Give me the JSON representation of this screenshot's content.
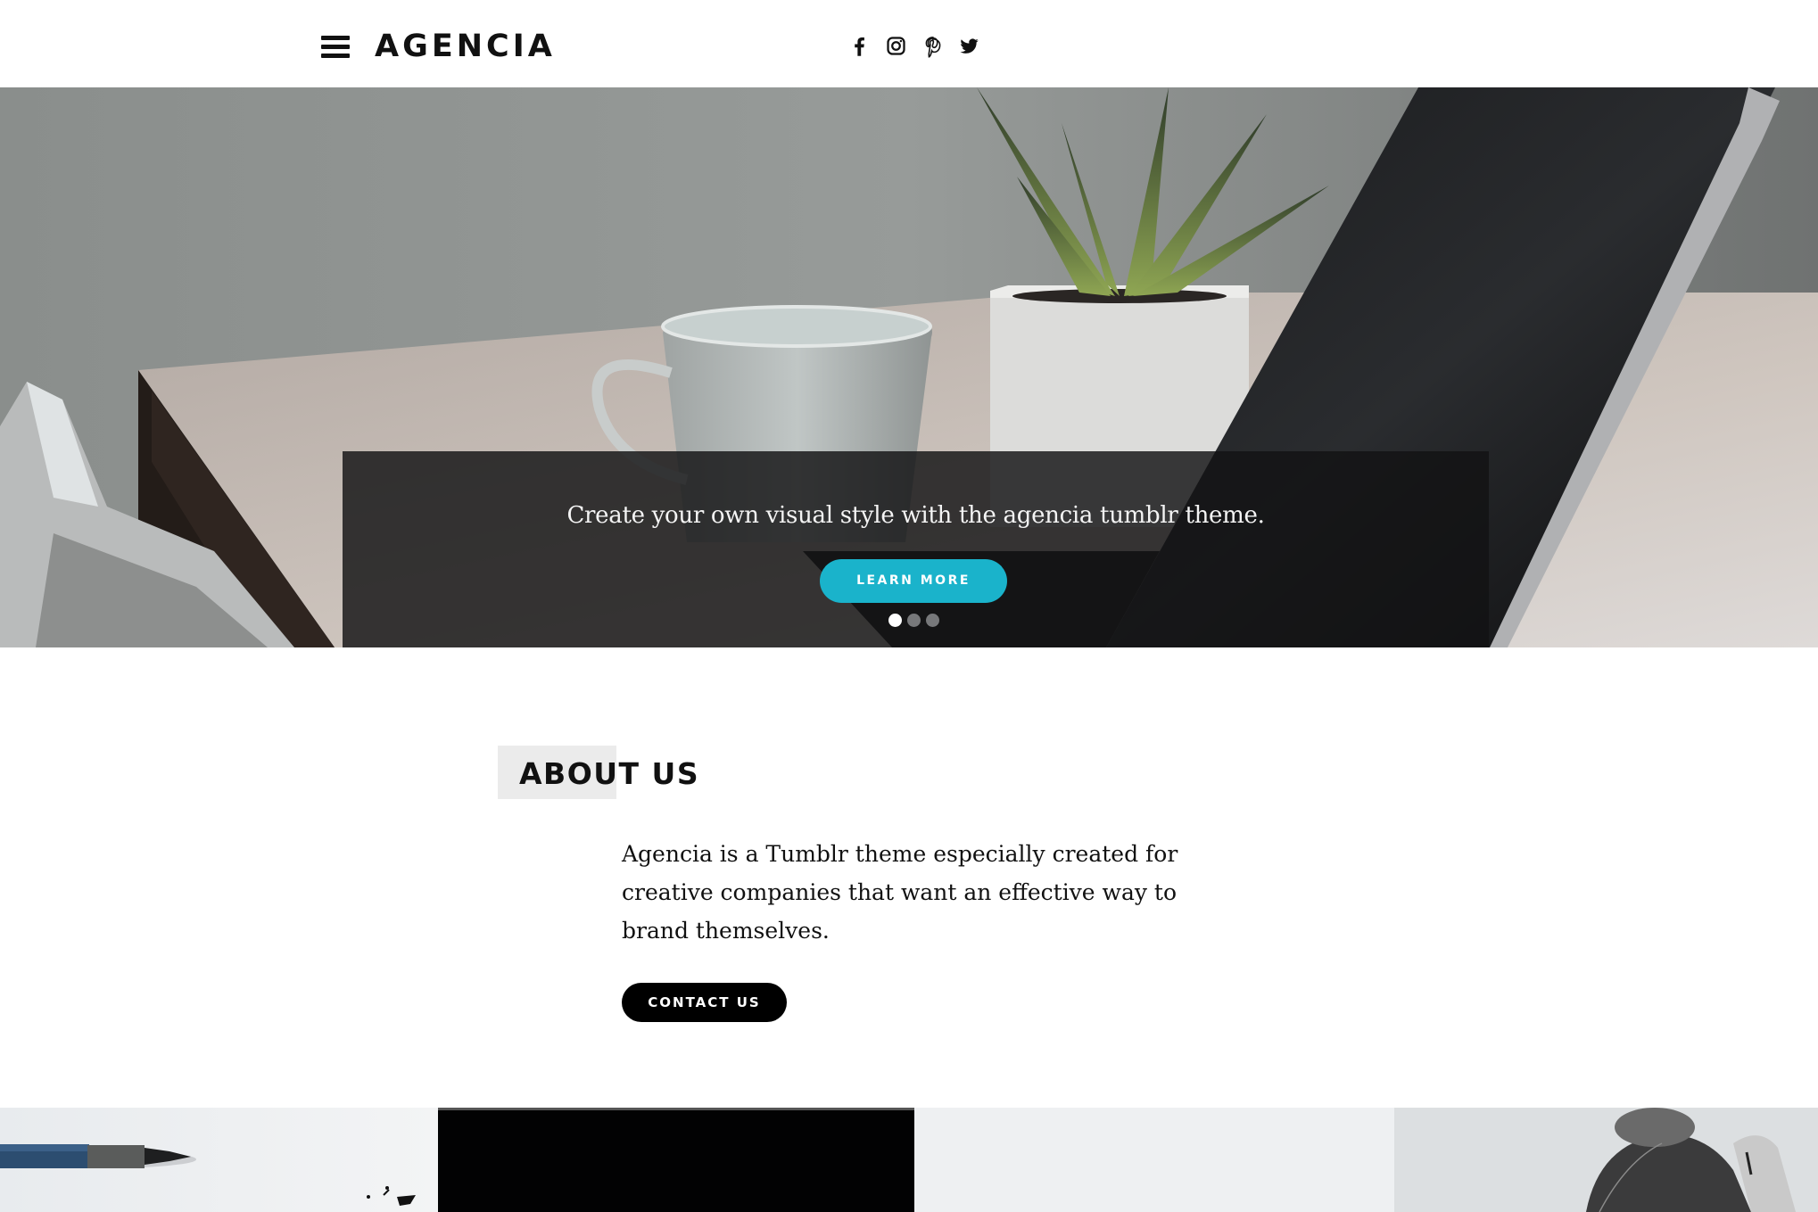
{
  "header": {
    "logo": "AGENCIA",
    "menu_icon": "hamburger-menu-icon",
    "social": [
      {
        "name": "facebook",
        "icon": "facebook-icon"
      },
      {
        "name": "instagram",
        "icon": "instagram-icon"
      },
      {
        "name": "pinterest",
        "icon": "pinterest-icon"
      },
      {
        "name": "twitter",
        "icon": "twitter-icon"
      }
    ]
  },
  "hero": {
    "caption": "Create your own visual style with the agencia tumblr theme.",
    "button_label": "LEARN MORE",
    "slides_total": 3,
    "active_slide": 1,
    "accent_color": "#1ab3cb"
  },
  "about": {
    "title": "ABOUT US",
    "text": "Agencia is a Tumblr theme especially created for creative companies that want an effective way to brand themselves.",
    "button_label": "CONTACT US"
  },
  "gallery": {
    "tiles": [
      {
        "subject": "pen on white paper"
      },
      {
        "subject": "black"
      },
      {
        "subject": "light grey"
      },
      {
        "subject": "woman with hair bun"
      }
    ]
  }
}
